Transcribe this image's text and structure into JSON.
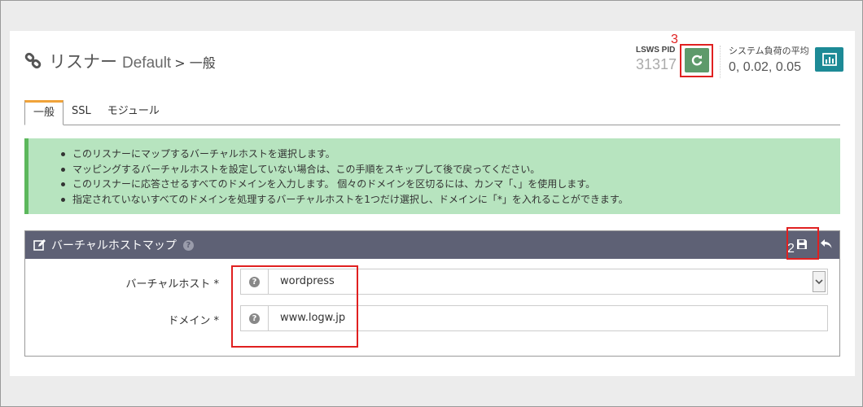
{
  "header": {
    "title": "リスナー",
    "listener_name": "Default",
    "breadcrumb": "> 一般"
  },
  "status": {
    "pid_label": "LSWS PID",
    "pid_value": "31317",
    "load_label": "システム負荷の平均",
    "load_value": "0, 0.02, 0.05"
  },
  "annotations": {
    "marker_restart": "3",
    "marker_save": "2"
  },
  "tabs": [
    {
      "label": "一般",
      "active": true
    },
    {
      "label": "SSL",
      "active": false
    },
    {
      "label": "モジュール",
      "active": false
    }
  ],
  "info": {
    "items": [
      "このリスナーにマップするバーチャルホストを選択します。",
      "マッピングするバーチャルホストを設定していない場合は、この手順をスキップして後で戻ってください。",
      "このリスナーに応答させるすべてのドメインを入力します。 個々のドメインを区切るには、カンマ「、」を使用します。",
      "指定されていないすべてのドメインを処理するバーチャルホストを1つだけ選択し、ドメインに「*」を入れることができます。"
    ]
  },
  "vhost_map": {
    "title": "バーチャルホストマップ",
    "fields": {
      "vhost_label": "バーチャルホスト *",
      "vhost_value": "wordpress",
      "domain_label": "ドメイン *",
      "domain_value": "www.logw.jp"
    }
  },
  "colors": {
    "restart_button": "#5e9a6b",
    "stats_button": "#1d8a96",
    "panel_header": "#5e6175",
    "info_bg": "#b7e4bf",
    "tab_accent": "#f0a33a",
    "annotation": "#e02020"
  },
  "icons": {
    "title": "link-icon",
    "restart": "refresh-icon",
    "stats": "bar-chart-icon",
    "edit": "edit-icon",
    "save": "floppy-disk-icon",
    "undo": "undo-icon",
    "help": "help-icon",
    "select": "chevron-down-icon"
  }
}
